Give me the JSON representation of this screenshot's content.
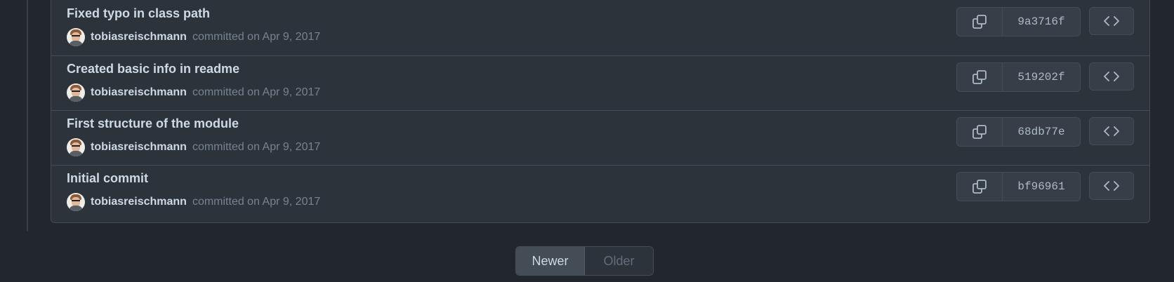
{
  "commits": [
    {
      "title": "Fixed typo in class path",
      "author": "tobiasreischmann",
      "date_text": "committed on Apr 9, 2017",
      "sha": "9a3716f"
    },
    {
      "title": "Created basic info in readme",
      "author": "tobiasreischmann",
      "date_text": "committed on Apr 9, 2017",
      "sha": "519202f"
    },
    {
      "title": "First structure of the module",
      "author": "tobiasreischmann",
      "date_text": "committed on Apr 9, 2017",
      "sha": "68db77e"
    },
    {
      "title": "Initial commit",
      "author": "tobiasreischmann",
      "date_text": "committed on Apr 9, 2017",
      "sha": "bf96961"
    }
  ],
  "pagination": {
    "newer_label": "Newer",
    "older_label": "Older"
  },
  "icons": {
    "copy": "copy-icon",
    "browse": "code-icon"
  },
  "colors": {
    "background": "#22272e",
    "panel": "#2d333b",
    "border": "#444c56",
    "title_text": "#cdd9e5",
    "muted_text": "#768390"
  }
}
